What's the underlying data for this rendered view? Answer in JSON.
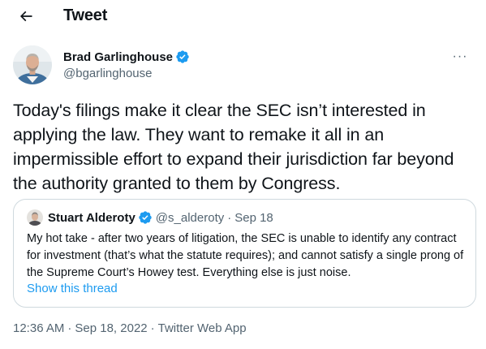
{
  "header": {
    "title": "Tweet",
    "back_icon": "arrow-left-icon"
  },
  "tweet": {
    "author_name": "Brad Garlinghouse",
    "author_handle": "@bgarlinghouse",
    "verified_icon": "verified-badge-icon",
    "more_icon": "more-horizontal-icon",
    "more_label": "···",
    "text": "Today's filings make it clear the SEC isn’t interested in applying the law. They want to remake it all in an impermissible effort to expand their jurisdiction far beyond the authority granted to them by Congress."
  },
  "quote": {
    "author_name": "Stuart Alderoty",
    "author_handle": "@s_alderoty",
    "separator": "·",
    "date": "Sep 18",
    "text": "My hot take - after two years of litigation, the SEC is unable to identify any contract for investment (that’s what the statute requires); and cannot satisfy a single prong of the Supreme Court’s Howey test. Everything else is just noise.",
    "show_thread": "Show this thread"
  },
  "meta": {
    "time": "12:36 AM",
    "separator": "·",
    "date": "Sep 18, 2022",
    "source": "Twitter Web App"
  },
  "colors": {
    "text_primary": "#0f1419",
    "text_secondary": "#536471",
    "accent": "#1d9bf0",
    "border": "#cfd9de"
  }
}
